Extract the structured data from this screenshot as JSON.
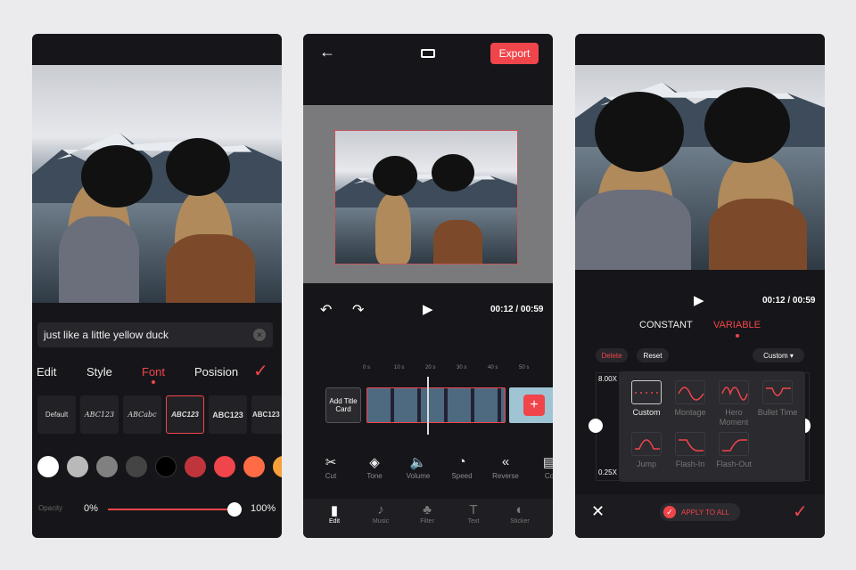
{
  "colors": {
    "accent": "#f0454a",
    "background": "#ebebee",
    "phone": "#16161a"
  },
  "phone1": {
    "text_input": {
      "value": "just like a little yellow duck",
      "clear_icon": "close-circle-icon"
    },
    "tabs": [
      {
        "label": "Edit"
      },
      {
        "label": "Style"
      },
      {
        "label": "Font",
        "active": true
      },
      {
        "label": "Posision"
      }
    ],
    "confirm_icon": "check-icon",
    "fonts": [
      {
        "label": "Default"
      },
      {
        "label": "ABC123",
        "download": true
      },
      {
        "label": "ABCabc",
        "download": true
      },
      {
        "label": "ABC123",
        "selected": true
      },
      {
        "label": "ABC123",
        "download": true
      },
      {
        "label": "ABC123",
        "download": true
      }
    ],
    "swatches": [
      "#ffffff",
      "#b9b9b9",
      "#808080",
      "#444444",
      "#000000",
      "#c0343c",
      "#f0454a",
      "#ff6b45",
      "#f7a03a"
    ],
    "opacity": {
      "label": "Opacity",
      "min": "0%",
      "max": "100%",
      "value_percent": 100
    }
  },
  "phone2": {
    "back_icon": "arrow-left-icon",
    "aspect_icon": "aspect-ratio-icon",
    "export_label": "Export",
    "undo_icon": "undo-icon",
    "redo_icon": "redo-icon",
    "play_icon": "play-icon",
    "time": "00:12 / 00:59",
    "ruler": [
      "0 s",
      "10 s",
      "20 s",
      "30 s",
      "40 s",
      "50 s"
    ],
    "add_title_card": "Add Title Card",
    "tools": [
      {
        "label": "Cut",
        "icon": "scissors-icon"
      },
      {
        "label": "Tone",
        "icon": "tone-icon"
      },
      {
        "label": "Volume",
        "icon": "volume-icon"
      },
      {
        "label": "Speed",
        "icon": "speed-icon"
      },
      {
        "label": "Reverse",
        "icon": "reverse-icon"
      },
      {
        "label": "Co",
        "icon": "copy-icon"
      }
    ],
    "nav": [
      {
        "label": "Edit",
        "icon": "edit-icon",
        "active": true
      },
      {
        "label": "Music",
        "icon": "music-icon"
      },
      {
        "label": "Filter",
        "icon": "filter-icon"
      },
      {
        "label": "Text",
        "icon": "text-icon"
      },
      {
        "label": "Sticker",
        "icon": "sticker-icon"
      }
    ]
  },
  "phone3": {
    "time": "00:12 / 00:59",
    "tabs": [
      {
        "label": "CONSTANT"
      },
      {
        "label": "VARIABLE",
        "active": true
      }
    ],
    "delete_label": "Delete",
    "reset_label": "Reset",
    "preset_select": "Custom",
    "graph": {
      "max": "8.00X",
      "min": "0.25X"
    },
    "presets": [
      {
        "label": "Custom",
        "selected": true
      },
      {
        "label": "Montage"
      },
      {
        "label": "Hero Moment"
      },
      {
        "label": "Bullet Time"
      },
      {
        "label": "Jump"
      },
      {
        "label": "Flash-In"
      },
      {
        "label": "Flash-Out"
      }
    ],
    "close_icon": "close-icon",
    "apply_all_label": "APPLY TO ALL",
    "confirm_icon": "check-icon"
  }
}
